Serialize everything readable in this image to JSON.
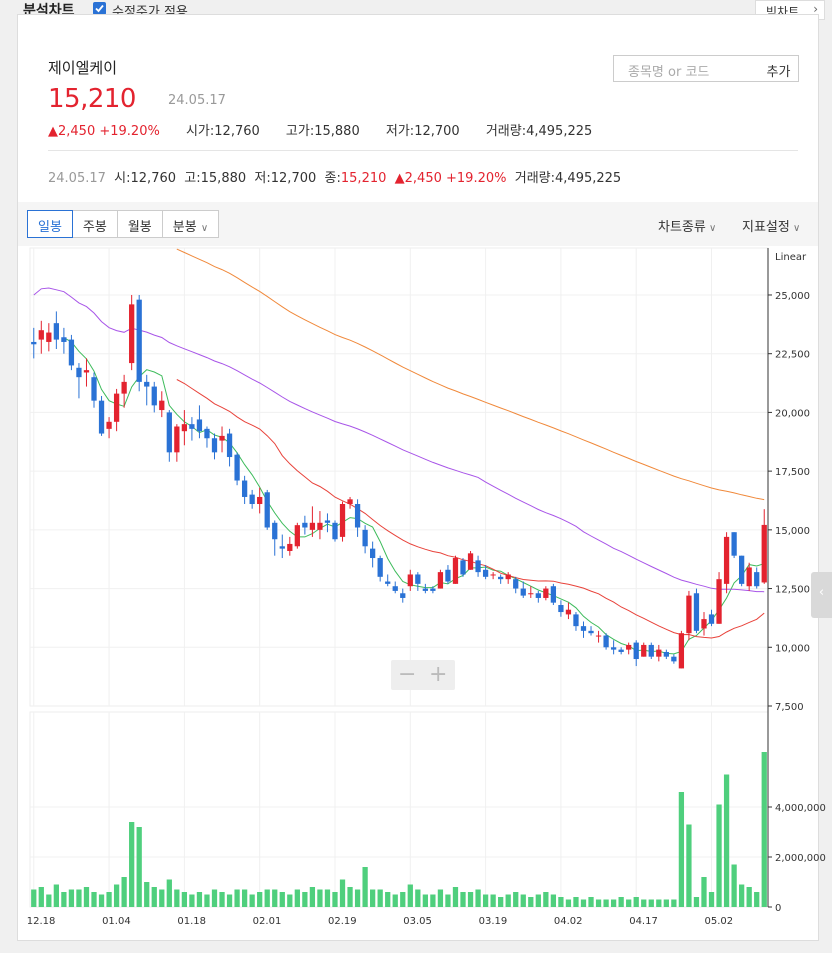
{
  "topbar": {
    "title": "분석차트",
    "adjusted_label": "수정주가 적용",
    "adjusted_checked": true,
    "big_chart_label": "빅차트",
    "big_chart_icon": "chevron-right-icon"
  },
  "stock": {
    "name": "제이엘케이",
    "price": "15,210",
    "date": "24.05.17",
    "change": "▲2,450",
    "change_pct": "+19.20%",
    "open_label": "시가",
    "open": "12,760",
    "high_label": "고가",
    "high": "15,880",
    "low_label": "저가",
    "low": "12,700",
    "volume_label": "거래량",
    "volume": "4,495,225"
  },
  "search": {
    "placeholder": "종목명 or 코드",
    "add_label": "추가"
  },
  "info": {
    "date": "24.05.17",
    "o_label": "시",
    "o": "12,760",
    "h_label": "고",
    "h": "15,880",
    "l_label": "저",
    "l": "12,700",
    "c_label": "종",
    "c": "15,210",
    "change": "▲2,450",
    "change_pct": "+19.20%",
    "vol_label": "거래량",
    "vol": "4,495,225"
  },
  "tabs": [
    {
      "label": "일봉",
      "active": true
    },
    {
      "label": "주봉",
      "active": false
    },
    {
      "label": "월봉",
      "active": false
    },
    {
      "label": "분봉",
      "active": false,
      "dropdown": true
    }
  ],
  "controls": {
    "chart_type": "차트종류",
    "indicator": "지표설정"
  },
  "zoom": {
    "minus": "−",
    "plus": "+"
  },
  "colors": {
    "up": "#e3232f",
    "down": "#2a72d5",
    "ma5": "#3dbb5b",
    "ma20": "#e8423a",
    "ma60": "#a855e8",
    "ma120": "#f0893b",
    "volume": "#4fcf7d"
  },
  "chart_data": {
    "type": "candlestick",
    "scale_label": "Linear",
    "price_ticks": [
      "25,000",
      "22,500",
      "20,000",
      "17,500",
      "15,000",
      "12,500",
      "10,000",
      "7,500"
    ],
    "price_tick_values": [
      25000,
      22500,
      20000,
      17500,
      15000,
      12500,
      10000,
      7500
    ],
    "ylim": [
      7500,
      27000
    ],
    "volume_ticks": [
      "4,000,000",
      "2,000,000",
      "0"
    ],
    "volume_tick_values": [
      4000000,
      2000000,
      0
    ],
    "volume_ylim": [
      0,
      6200000
    ],
    "x_tick_labels": [
      "12.18",
      "01.04",
      "01.18",
      "02.01",
      "02.19",
      "03.05",
      "03.19",
      "04.02",
      "04.17",
      "05.02"
    ],
    "x_tick_index": [
      0,
      10,
      20,
      30,
      40,
      50,
      60,
      70,
      80,
      90
    ],
    "candles": [
      [
        23000,
        23600,
        22300,
        22900
      ],
      [
        23100,
        23900,
        22500,
        23500
      ],
      [
        23000,
        23800,
        22600,
        23400
      ],
      [
        23800,
        24300,
        22700,
        23100
      ],
      [
        23200,
        23600,
        22500,
        23000
      ],
      [
        23100,
        23300,
        21800,
        22000
      ],
      [
        21900,
        22100,
        20600,
        21500
      ],
      [
        21700,
        22300,
        21100,
        21800
      ],
      [
        21500,
        21700,
        20200,
        20500
      ],
      [
        20500,
        20700,
        19000,
        19100
      ],
      [
        19300,
        19800,
        18900,
        19600
      ],
      [
        19600,
        21000,
        19200,
        20800
      ],
      [
        20800,
        21600,
        20200,
        21300
      ],
      [
        22100,
        25000,
        21800,
        24600
      ],
      [
        24800,
        25000,
        20900,
        21300
      ],
      [
        21300,
        21600,
        20300,
        21100
      ],
      [
        21100,
        21300,
        20000,
        20300
      ],
      [
        20100,
        20900,
        19800,
        20500
      ],
      [
        20000,
        20100,
        17900,
        18300
      ],
      [
        18300,
        19500,
        17900,
        19400
      ],
      [
        19200,
        20100,
        18600,
        19500
      ],
      [
        19500,
        19800,
        18800,
        19300
      ],
      [
        19700,
        20300,
        18900,
        19200
      ],
      [
        19300,
        19400,
        18500,
        18900
      ],
      [
        18900,
        19100,
        18000,
        18300
      ],
      [
        18800,
        19400,
        18300,
        19000
      ],
      [
        19100,
        19300,
        17700,
        18100
      ],
      [
        18200,
        18300,
        16900,
        17100
      ],
      [
        17100,
        17300,
        16100,
        16400
      ],
      [
        16500,
        16700,
        15900,
        16100
      ],
      [
        16100,
        16800,
        15700,
        16400
      ],
      [
        16600,
        16700,
        15000,
        15100
      ],
      [
        15300,
        15400,
        13900,
        14600
      ],
      [
        14300,
        14800,
        13800,
        14200
      ],
      [
        14100,
        14700,
        13900,
        14400
      ],
      [
        14300,
        15300,
        14200,
        15200
      ],
      [
        15300,
        15600,
        14800,
        15100
      ],
      [
        15000,
        16000,
        14700,
        15300
      ],
      [
        15000,
        15800,
        14600,
        15300
      ],
      [
        15400,
        15700,
        14900,
        15300
      ],
      [
        15300,
        15400,
        14500,
        14600
      ],
      [
        14700,
        16200,
        14500,
        16100
      ],
      [
        16100,
        16400,
        15900,
        16300
      ],
      [
        16100,
        16300,
        14700,
        15100
      ],
      [
        15000,
        15200,
        14000,
        14300
      ],
      [
        14200,
        14500,
        13400,
        13800
      ],
      [
        13800,
        13900,
        12800,
        13000
      ],
      [
        12800,
        13100,
        12600,
        12700
      ],
      [
        12600,
        12800,
        12300,
        12400
      ],
      [
        12300,
        12500,
        11900,
        12100
      ],
      [
        12600,
        13300,
        12400,
        13100
      ],
      [
        13100,
        13200,
        12400,
        12700
      ],
      [
        12500,
        12700,
        12300,
        12400
      ],
      [
        12500,
        12600,
        12300,
        12400
      ],
      [
        12500,
        13300,
        12500,
        13200
      ],
      [
        13300,
        13500,
        12700,
        12800
      ],
      [
        12700,
        13900,
        12700,
        13800
      ],
      [
        13700,
        13800,
        13000,
        13100
      ],
      [
        13300,
        14100,
        13300,
        14000
      ],
      [
        13700,
        13900,
        13000,
        13200
      ],
      [
        13300,
        13500,
        12900,
        13000
      ],
      [
        13100,
        13200,
        12900,
        13100
      ],
      [
        13000,
        13100,
        12700,
        12900
      ],
      [
        12900,
        13200,
        12700,
        13100
      ],
      [
        12900,
        13000,
        12300,
        12500
      ],
      [
        12500,
        12800,
        12100,
        12200
      ],
      [
        12300,
        12600,
        12100,
        12300
      ],
      [
        12300,
        12400,
        11900,
        12100
      ],
      [
        12100,
        12600,
        12000,
        12500
      ],
      [
        12600,
        12700,
        11800,
        11900
      ],
      [
        11800,
        12000,
        11300,
        11500
      ],
      [
        11400,
        11900,
        11200,
        11600
      ],
      [
        11400,
        11500,
        10700,
        10900
      ],
      [
        10900,
        11100,
        10400,
        10700
      ],
      [
        10700,
        10900,
        10500,
        10600
      ],
      [
        10500,
        10700,
        10200,
        10500
      ],
      [
        10500,
        10600,
        9900,
        10000
      ],
      [
        10000,
        10300,
        9700,
        9900
      ],
      [
        9900,
        10000,
        9700,
        9800
      ],
      [
        9900,
        10200,
        9700,
        10100
      ],
      [
        10200,
        10300,
        9200,
        9500
      ],
      [
        9600,
        10200,
        9600,
        10100
      ],
      [
        10100,
        10200,
        9500,
        9600
      ],
      [
        9600,
        10100,
        9400,
        9900
      ],
      [
        9800,
        9900,
        9500,
        9600
      ],
      [
        9600,
        9700,
        9300,
        9400
      ],
      [
        9100,
        10700,
        9100,
        10600
      ],
      [
        10600,
        12400,
        10300,
        12200
      ],
      [
        12300,
        12500,
        10600,
        10700
      ],
      [
        10800,
        11500,
        10500,
        11200
      ],
      [
        11400,
        11600,
        10900,
        11000
      ],
      [
        11000,
        13200,
        11000,
        12900
      ],
      [
        12700,
        14900,
        12300,
        14700
      ],
      [
        14900,
        14900,
        13800,
        13900
      ],
      [
        13900,
        13900,
        12600,
        12700
      ],
      [
        12600,
        13600,
        12400,
        13400
      ],
      [
        13200,
        13400,
        12500,
        12600
      ],
      [
        12760,
        15880,
        12700,
        15210
      ]
    ],
    "volumes": [
      700000,
      800000,
      500000,
      900000,
      600000,
      700000,
      700000,
      800000,
      600000,
      500000,
      600000,
      900000,
      1200000,
      3400000,
      3200000,
      1000000,
      800000,
      700000,
      1100000,
      700000,
      600000,
      500000,
      600000,
      500000,
      700000,
      600000,
      500000,
      700000,
      700000,
      500000,
      600000,
      700000,
      700000,
      600000,
      500000,
      700000,
      600000,
      800000,
      700000,
      700000,
      600000,
      1100000,
      800000,
      700000,
      1600000,
      700000,
      700000,
      600000,
      500000,
      600000,
      900000,
      700000,
      500000,
      500000,
      700000,
      500000,
      800000,
      600000,
      600000,
      700000,
      500000,
      500000,
      400000,
      500000,
      600000,
      500000,
      400000,
      500000,
      600000,
      500000,
      400000,
      300000,
      400000,
      300000,
      400000,
      300000,
      300000,
      300000,
      400000,
      300000,
      400000,
      300000,
      300000,
      300000,
      300000,
      300000,
      4600000,
      3300000,
      400000,
      1200000,
      600000,
      4100000,
      5300000,
      1700000,
      900000,
      800000,
      600000,
      6200000
    ],
    "series": []
  }
}
